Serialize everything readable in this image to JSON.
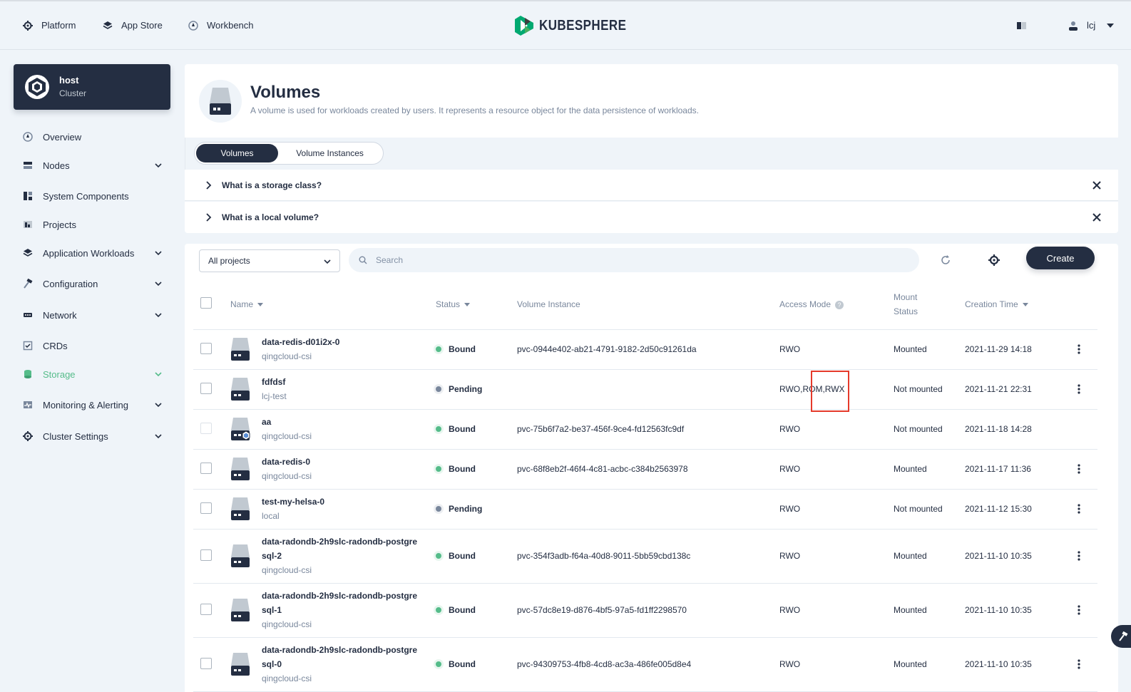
{
  "topbar": {
    "nav": [
      {
        "label": "Platform",
        "icon": "gear-icon"
      },
      {
        "label": "App Store",
        "icon": "layers-icon"
      },
      {
        "label": "Workbench",
        "icon": "dashboard-icon"
      }
    ],
    "logo_text": "KUBESPHERE",
    "user": "lcj"
  },
  "sidebar": {
    "cluster": {
      "name": "host",
      "sub": "Cluster"
    },
    "items": [
      {
        "label": "Overview",
        "icon": "dashboard-icon",
        "expandable": false
      },
      {
        "label": "Nodes",
        "icon": "server-icon",
        "expandable": true
      },
      {
        "label": "System Components",
        "icon": "components-icon",
        "expandable": false
      },
      {
        "label": "Projects",
        "icon": "project-icon",
        "expandable": false
      },
      {
        "label": "Application Workloads",
        "icon": "layers-icon",
        "expandable": true
      },
      {
        "label": "Configuration",
        "icon": "hammer-icon",
        "expandable": true
      },
      {
        "label": "Network",
        "icon": "network-icon",
        "expandable": true
      },
      {
        "label": "CRDs",
        "icon": "crd-icon",
        "expandable": false
      },
      {
        "label": "Storage",
        "icon": "storage-icon",
        "expandable": true,
        "active": true
      },
      {
        "label": "Monitoring & Alerting",
        "icon": "monitor-icon",
        "expandable": true
      },
      {
        "label": "Cluster Settings",
        "icon": "gear-icon",
        "expandable": true
      }
    ]
  },
  "header": {
    "title": "Volumes",
    "description": "A volume is used for workloads created by users. It represents a resource object for the data persistence of workloads."
  },
  "tabs": [
    {
      "label": "Volumes",
      "active": true
    },
    {
      "label": "Volume Instances",
      "active": false
    }
  ],
  "faq": [
    {
      "label": "What is a storage class?"
    },
    {
      "label": "What is a local volume?"
    }
  ],
  "toolbar": {
    "project_select": "All projects",
    "search_placeholder": "Search",
    "create_label": "Create"
  },
  "table": {
    "columns": {
      "name": "Name",
      "status": "Status",
      "instance": "Volume Instance",
      "access": "Access Mode",
      "mount_line1": "Mount",
      "mount_line2": "Status",
      "created": "Creation Time"
    },
    "rows": [
      {
        "name": "data-redis-d01i2x-0",
        "name2": "",
        "storage_class": "qingcloud-csi",
        "status": "Bound",
        "instance": "pvc-0944e402-ab21-4791-9182-2d50c91261da",
        "access": "RWO",
        "mount": "Mounted",
        "created": "2021-11-29 14:18",
        "disabled": false,
        "special": false
      },
      {
        "name": "fdfdsf",
        "name2": "",
        "storage_class": "lcj-test",
        "status": "Pending",
        "instance": "",
        "access": "RWO,ROM,RWX",
        "mount": "Not mounted",
        "created": "2021-11-21 22:31",
        "disabled": false,
        "special": false
      },
      {
        "name": "aa",
        "name2": "",
        "storage_class": "qingcloud-csi",
        "status": "Bound",
        "instance": "pvc-75b6f7a2-be37-456f-9ce4-fd12563fc9df",
        "access": "RWO",
        "mount": "Not mounted",
        "created": "2021-11-18 14:28",
        "disabled": true,
        "special": true
      },
      {
        "name": "data-redis-0",
        "name2": "",
        "storage_class": "qingcloud-csi",
        "status": "Bound",
        "instance": "pvc-68f8eb2f-46f4-4c81-acbc-c384b2563978",
        "access": "RWO",
        "mount": "Mounted",
        "created": "2021-11-17 11:36",
        "disabled": false,
        "special": false
      },
      {
        "name": "test-my-helsa-0",
        "name2": "",
        "storage_class": "local",
        "status": "Pending",
        "instance": "",
        "access": "RWO",
        "mount": "Not mounted",
        "created": "2021-11-12 15:30",
        "disabled": false,
        "special": false
      },
      {
        "name": "data-radondb-2h9slc-radondb-postgre",
        "name2": "sql-2",
        "storage_class": "qingcloud-csi",
        "status": "Bound",
        "instance": "pvc-354f3adb-f64a-40d8-9011-5bb59cbd138c",
        "access": "RWO",
        "mount": "Mounted",
        "created": "2021-11-10 10:35",
        "disabled": false,
        "special": false
      },
      {
        "name": "data-radondb-2h9slc-radondb-postgre",
        "name2": "sql-1",
        "storage_class": "qingcloud-csi",
        "status": "Bound",
        "instance": "pvc-57dc8e19-d876-4bf5-97a5-fd1ff2298570",
        "access": "RWO",
        "mount": "Mounted",
        "created": "2021-11-10 10:35",
        "disabled": false,
        "special": false
      },
      {
        "name": "data-radondb-2h9slc-radondb-postgre",
        "name2": "sql-0",
        "storage_class": "qingcloud-csi",
        "status": "Bound",
        "instance": "pvc-94309753-4fb8-4cd8-ac3a-486fe005d8e4",
        "access": "RWO",
        "mount": "Mounted",
        "created": "2021-11-10 10:35",
        "disabled": false,
        "special": false
      }
    ]
  },
  "colors": {
    "primary": "#242e42",
    "accent_green": "#55bc8a",
    "pending_gray": "#79879c",
    "highlight_red": "#e53a2b"
  }
}
